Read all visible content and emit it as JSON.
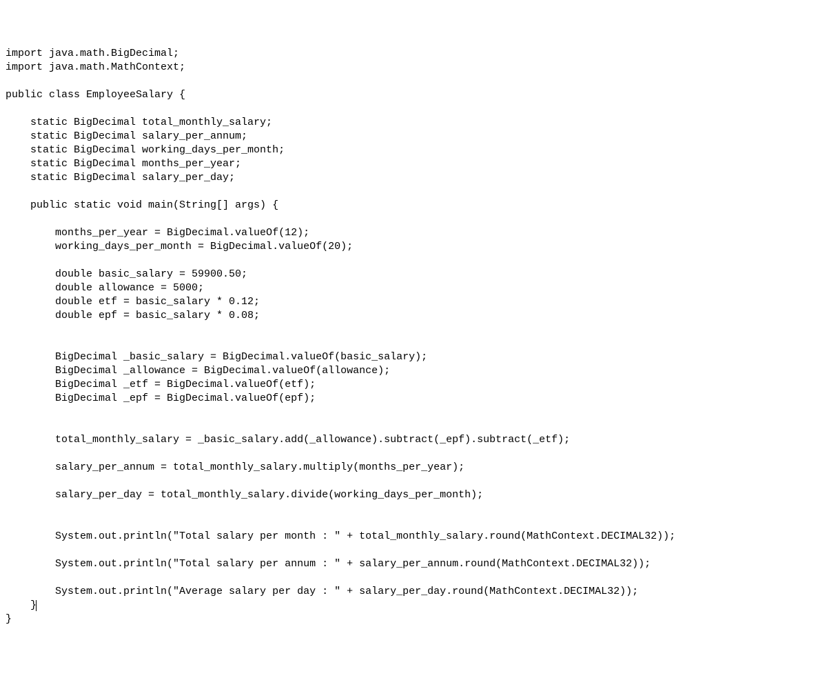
{
  "code": {
    "l1": "import java.math.BigDecimal;",
    "l2": "import java.math.MathContext;",
    "l3": "",
    "l4": "public class EmployeeSalary {",
    "l5": "",
    "l6": "    static BigDecimal total_monthly_salary;",
    "l7": "    static BigDecimal salary_per_annum;",
    "l8": "    static BigDecimal working_days_per_month;",
    "l9": "    static BigDecimal months_per_year;",
    "l10": "    static BigDecimal salary_per_day;",
    "l11": "",
    "l12": "    public static void main(String[] args) {",
    "l13": "",
    "l14": "        months_per_year = BigDecimal.valueOf(12);",
    "l15": "        working_days_per_month = BigDecimal.valueOf(20);",
    "l16": "",
    "l17": "        double basic_salary = 59900.50;",
    "l18": "        double allowance = 5000;",
    "l19": "        double etf = basic_salary * 0.12;",
    "l20": "        double epf = basic_salary * 0.08;",
    "l21": "",
    "l22": "",
    "l23": "        BigDecimal _basic_salary = BigDecimal.valueOf(basic_salary);",
    "l24": "        BigDecimal _allowance = BigDecimal.valueOf(allowance);",
    "l25": "        BigDecimal _etf = BigDecimal.valueOf(etf);",
    "l26": "        BigDecimal _epf = BigDecimal.valueOf(epf);",
    "l27": "",
    "l28": "",
    "l29": "        total_monthly_salary = _basic_salary.add(_allowance).subtract(_epf).subtract(_etf);",
    "l30": "",
    "l31": "        salary_per_annum = total_monthly_salary.multiply(months_per_year);",
    "l32": "",
    "l33": "        salary_per_day = total_monthly_salary.divide(working_days_per_month);",
    "l34": "",
    "l35": "",
    "l36": "        System.out.println(\"Total salary per month : \" + total_monthly_salary.round(MathContext.DECIMAL32));",
    "l37": "",
    "l38": "        System.out.println(\"Total salary per annum : \" + salary_per_annum.round(MathContext.DECIMAL32));",
    "l39": "",
    "l40": "        System.out.println(\"Average salary per day : \" + salary_per_day.round(MathContext.DECIMAL32));",
    "l41": "    }",
    "l42": "}"
  }
}
